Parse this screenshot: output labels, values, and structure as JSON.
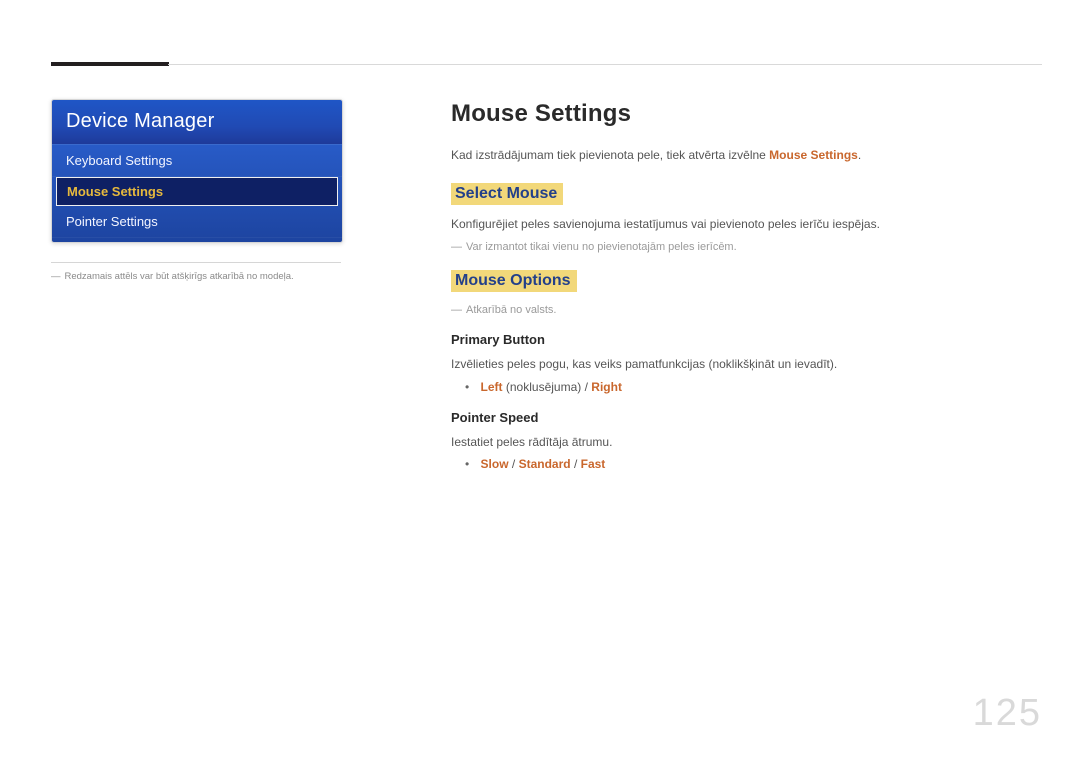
{
  "page_number": "125",
  "sidebar": {
    "title": "Device Manager",
    "items": [
      {
        "label": "Keyboard Settings",
        "selected": false
      },
      {
        "label": "Mouse Settings",
        "selected": true
      },
      {
        "label": "Pointer Settings",
        "selected": false
      }
    ],
    "image_note": "Redzamais attēls var būt atšķirīgs atkarībā no modeļa."
  },
  "main": {
    "title": "Mouse Settings",
    "intro_prefix": "Kad izstrādājumam tiek pievienota pele, tiek atvērta izvēlne ",
    "intro_highlight": "Mouse Settings",
    "intro_suffix": ".",
    "section_select_mouse": {
      "heading": "Select Mouse",
      "desc": "Konfigurējiet peles savienojuma iestatījumus vai pievienoto peles ierīču iespējas.",
      "note": "Var izmantot tikai vienu no pievienotajām peles ierīcēm."
    },
    "section_mouse_options": {
      "heading": "Mouse Options",
      "note": "Atkarībā no valsts.",
      "primary_button": {
        "heading": "Primary Button",
        "desc": "Izvēlieties peles pogu, kas veiks pamatfunkcijas (noklikšķināt un ievadīt).",
        "options": [
          "Left",
          "Right"
        ],
        "default_label_paren": "(noklusējuma)"
      },
      "pointer_speed": {
        "heading": "Pointer Speed",
        "desc": "Iestatiet peles rādītāja ātrumu.",
        "options": [
          "Slow",
          "Standard",
          "Fast"
        ]
      }
    }
  }
}
